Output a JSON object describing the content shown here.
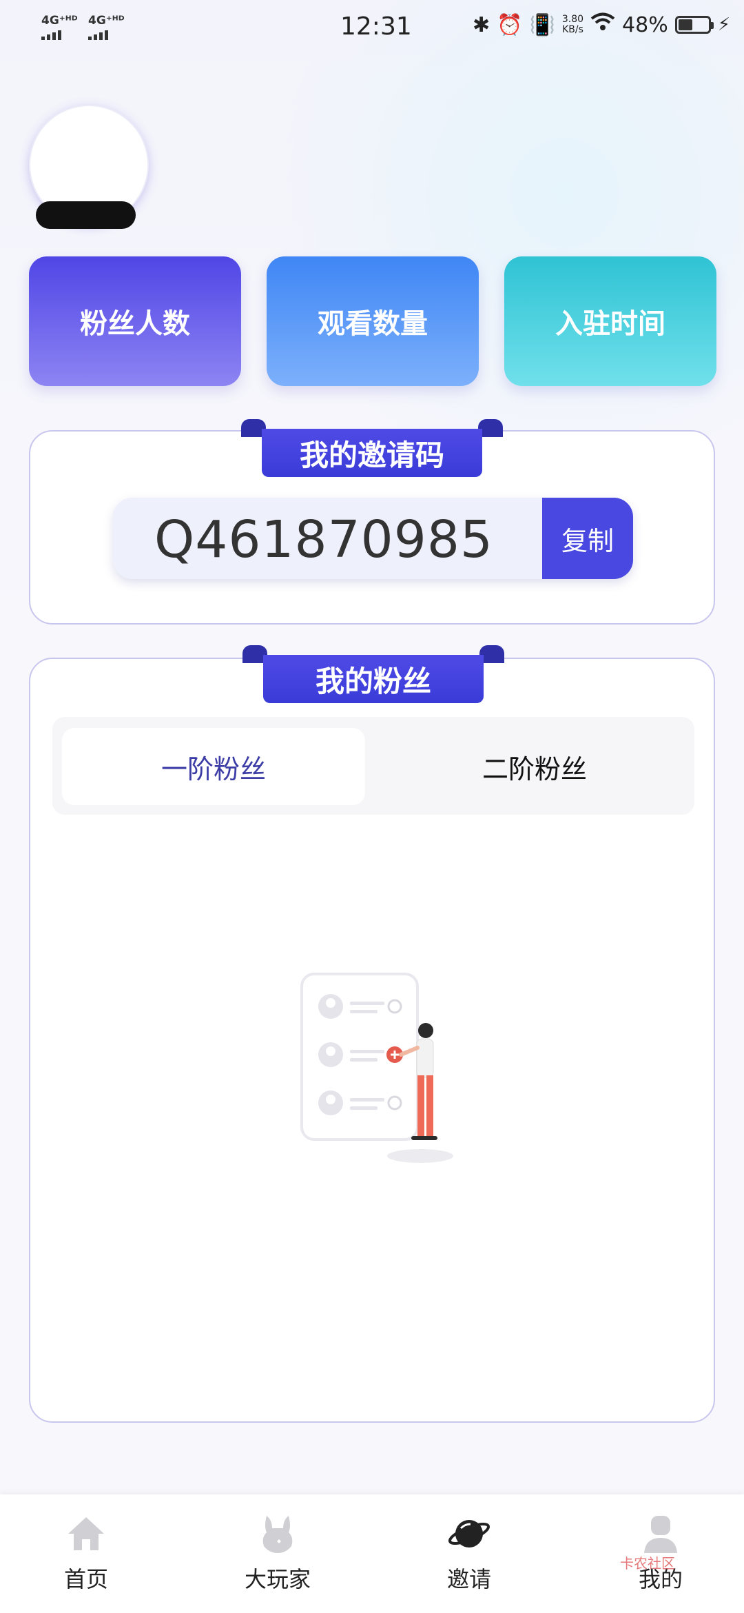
{
  "status_bar": {
    "signal1": "4G⁺ᴴᴰ",
    "signal2": "4G⁺ᴴᴰ",
    "time": "12:31",
    "speed_value": "3.80",
    "speed_unit": "KB/s",
    "battery_text": "48%",
    "battery_level": 0.48
  },
  "stats": {
    "fans_label": "粉丝人数",
    "views_label": "观看数量",
    "joined_label": "入驻时间"
  },
  "invite": {
    "title": "我的邀请码",
    "code": "Q461870985",
    "copy_label": "复制"
  },
  "fans": {
    "title": "我的粉丝",
    "tabs": [
      "一阶粉丝",
      "二阶粉丝"
    ],
    "active_tab": 0
  },
  "nav": {
    "items": [
      {
        "label": "首页",
        "icon": "home-icon"
      },
      {
        "label": "大玩家",
        "icon": "rabbit-icon"
      },
      {
        "label": "邀请",
        "icon": "planet-icon"
      },
      {
        "label": "我的",
        "icon": "profile-icon"
      }
    ],
    "active": 2
  },
  "watermark": "卡农社区",
  "colors": {
    "accent": "#4948e0",
    "card1": "#5046e6",
    "card2": "#3f86f5",
    "card3": "#2fc3d4"
  }
}
